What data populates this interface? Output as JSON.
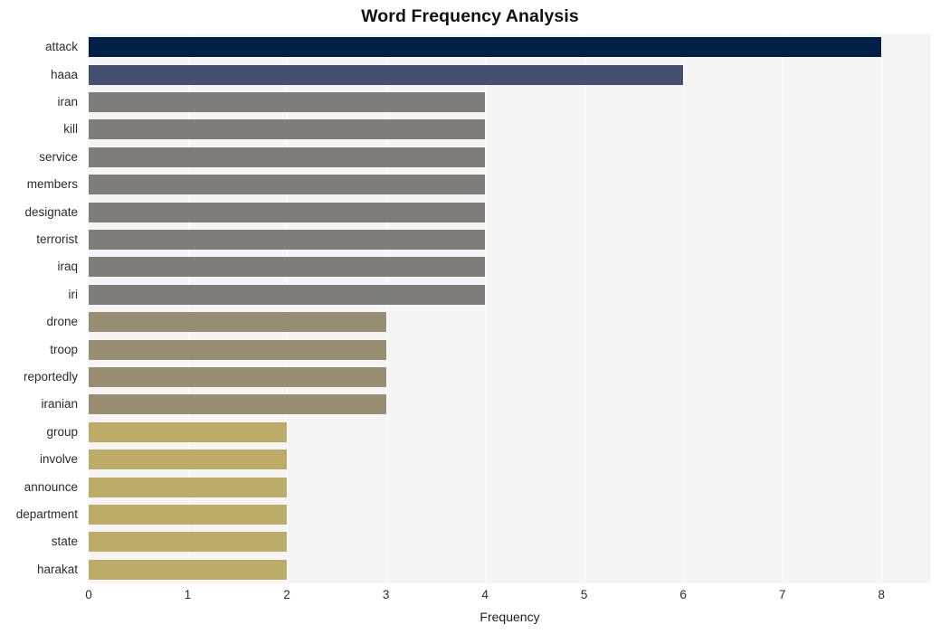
{
  "chart_data": {
    "type": "bar",
    "orientation": "horizontal",
    "title": "Word Frequency Analysis",
    "xlabel": "Frequency",
    "ylabel": "",
    "xlim": [
      0,
      8.5
    ],
    "xticks": [
      "0",
      "1",
      "2",
      "3",
      "4",
      "5",
      "6",
      "7",
      "8"
    ],
    "xtick_values": [
      0,
      1,
      2,
      3,
      4,
      5,
      6,
      7,
      8
    ],
    "grid": true,
    "grid_axis": "x",
    "legend": "none",
    "categories": [
      "attack",
      "haaa",
      "iran",
      "kill",
      "service",
      "members",
      "designate",
      "terrorist",
      "iraq",
      "iri",
      "drone",
      "troop",
      "reportedly",
      "iranian",
      "group",
      "involve",
      "announce",
      "department",
      "state",
      "harakat"
    ],
    "values": [
      8,
      6,
      4,
      4,
      4,
      4,
      4,
      4,
      4,
      4,
      3,
      3,
      3,
      3,
      2,
      2,
      2,
      2,
      2,
      2
    ],
    "bar_colors": [
      "#002147",
      "#454f70",
      "#7f7d79",
      "#7f7d79",
      "#7f7d79",
      "#7f7d79",
      "#7f7d79",
      "#7f7d79",
      "#7f7d79",
      "#7f7d79",
      "#988f72",
      "#988f72",
      "#988f72",
      "#988f72",
      "#bcac68",
      "#bcac68",
      "#bcac68",
      "#bcac68",
      "#bcac68",
      "#bcac68"
    ],
    "plot_background": "#f5f5f6",
    "grid_color": "#fdfdfd",
    "figure_background": "#ffffff"
  }
}
